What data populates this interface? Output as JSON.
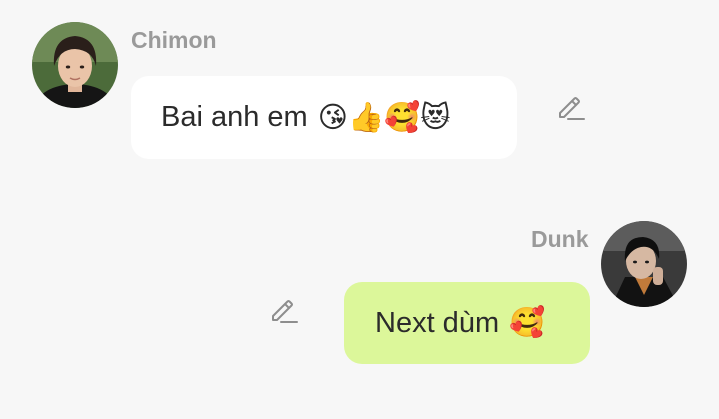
{
  "messages": [
    {
      "sender": "Chimon",
      "text": "Bai anh em",
      "emoji": "😘👍🥰😻",
      "avatar": "avatar-chimon",
      "side": "left",
      "bubble_color": "#ffffff"
    },
    {
      "sender": "Dunk",
      "text": "Next dùm",
      "emoji": "🥰",
      "avatar": "avatar-dunk",
      "side": "right",
      "bubble_color": "#dcf79a"
    }
  ],
  "icons": {
    "edit": "pencil-icon"
  },
  "colors": {
    "background": "#f7f7f7",
    "sender_name": "#9a9a9a",
    "incoming_bubble": "#ffffff",
    "outgoing_bubble": "#dcf79a",
    "message_text": "#2b2b2b",
    "icon": "#8e8e8e"
  }
}
